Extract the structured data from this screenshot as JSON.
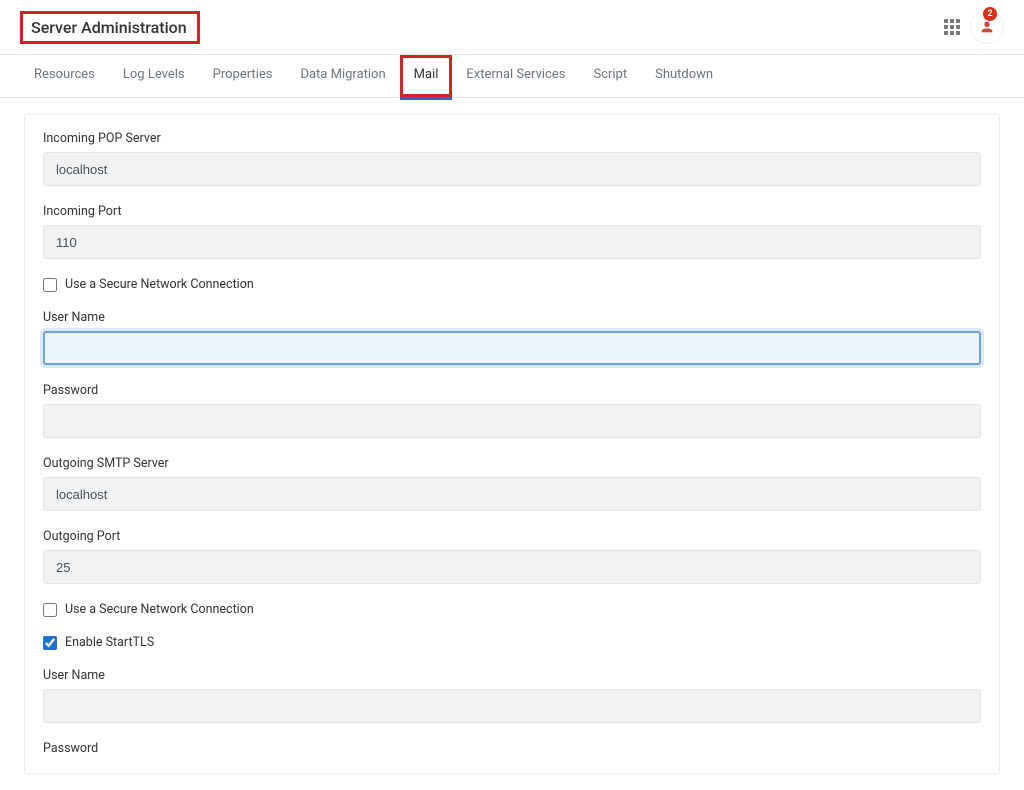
{
  "header": {
    "title": "Server Administration",
    "badge_count": "2"
  },
  "tabs": [
    {
      "label": "Resources",
      "active": false
    },
    {
      "label": "Log Levels",
      "active": false
    },
    {
      "label": "Properties",
      "active": false
    },
    {
      "label": "Data Migration",
      "active": false
    },
    {
      "label": "Mail",
      "active": true
    },
    {
      "label": "External Services",
      "active": false
    },
    {
      "label": "Script",
      "active": false
    },
    {
      "label": "Shutdown",
      "active": false
    }
  ],
  "form": {
    "incoming_pop_server": {
      "label": "Incoming POP Server",
      "value": "localhost"
    },
    "incoming_port": {
      "label": "Incoming Port",
      "value": "110"
    },
    "incoming_secure": {
      "label": "Use a Secure Network Connection",
      "checked": false
    },
    "user_name": {
      "label": "User Name",
      "value": ""
    },
    "password": {
      "label": "Password",
      "value": ""
    },
    "outgoing_smtp_server": {
      "label": "Outgoing SMTP Server",
      "value": "localhost"
    },
    "outgoing_port": {
      "label": "Outgoing Port",
      "value": "25"
    },
    "outgoing_secure": {
      "label": "Use a Secure Network Connection",
      "checked": false
    },
    "enable_starttls": {
      "label": "Enable StartTLS",
      "checked": true
    },
    "user_name_out": {
      "label": "User Name",
      "value": ""
    },
    "password_out": {
      "label": "Password",
      "value": ""
    }
  }
}
